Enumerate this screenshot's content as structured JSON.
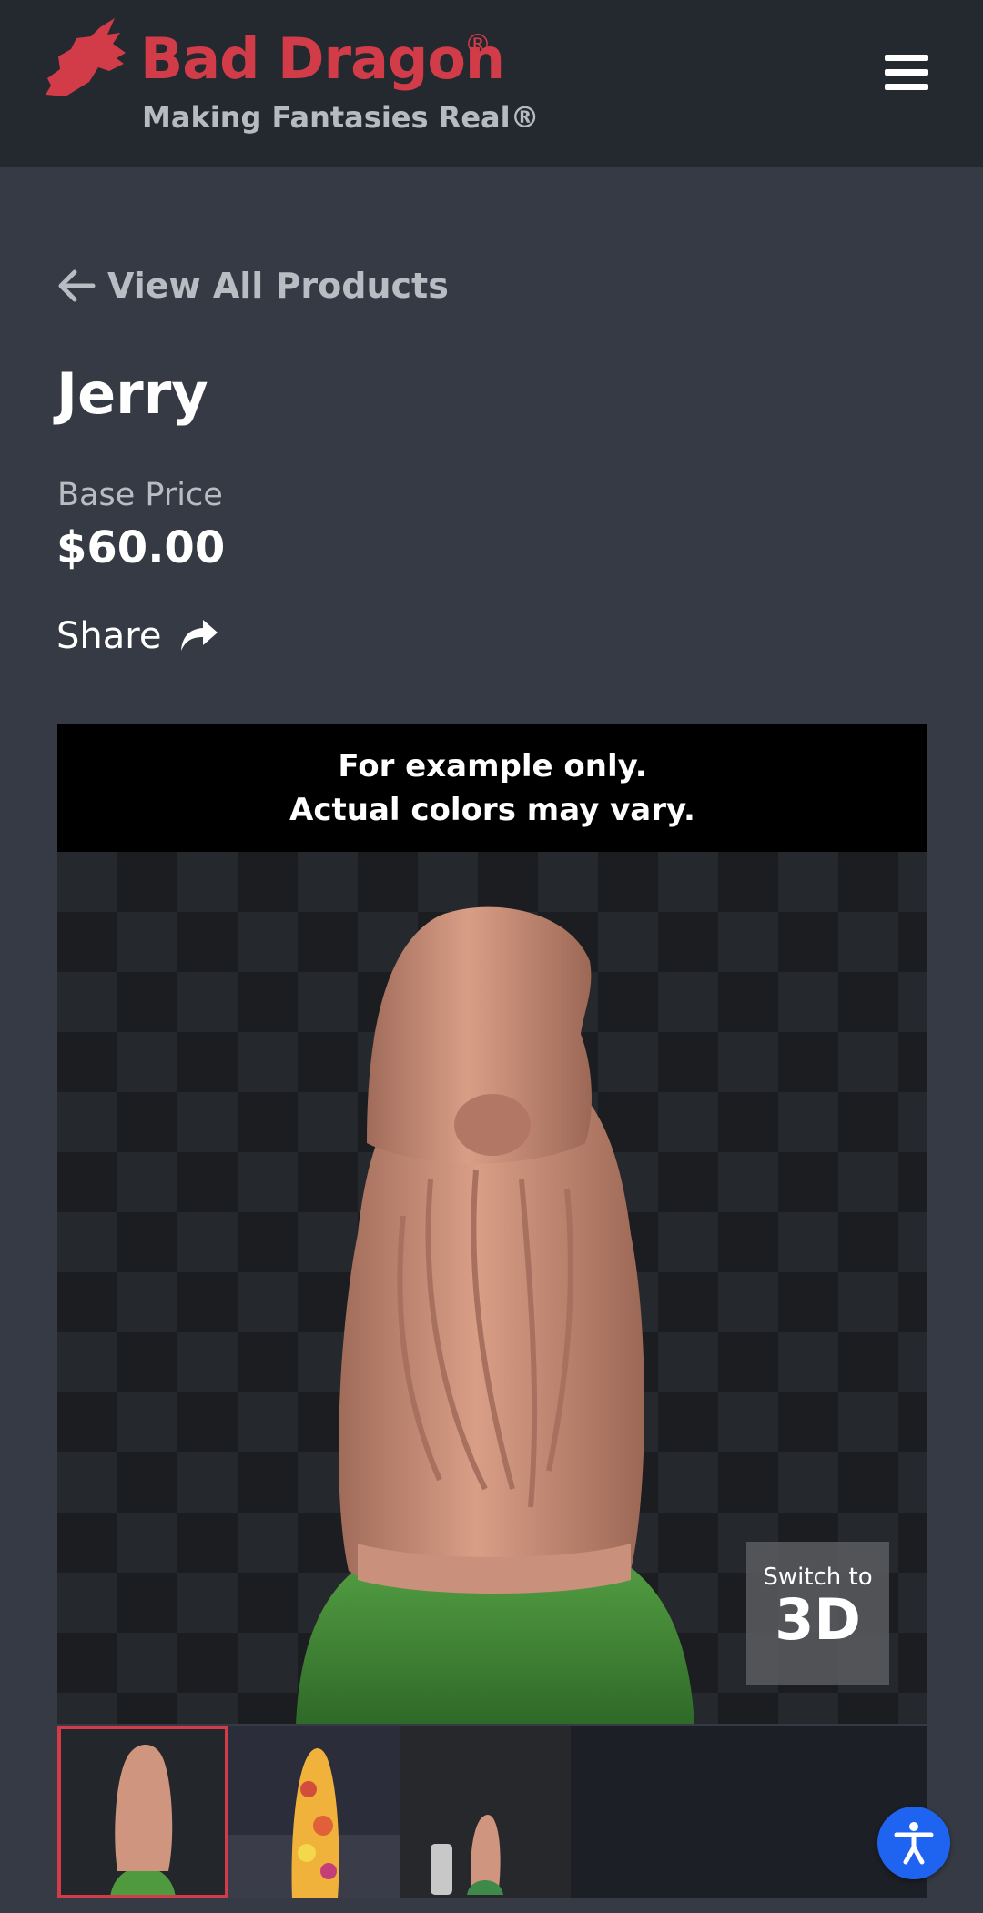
{
  "header": {
    "brand_name": "Bad Dragon",
    "brand_reg": "®",
    "tagline": "Making Fantasies Real®",
    "logo_icon": "dragon-head-logo",
    "menu_icon": "hamburger-menu-icon"
  },
  "nav": {
    "back_label": "View All Products",
    "back_icon": "arrow-left-icon"
  },
  "product": {
    "name": "Jerry",
    "price_label": "Base Price",
    "price": "$60.00",
    "share_label": "Share",
    "share_icon": "share-arrow-icon"
  },
  "viewer": {
    "disclaimer_line1": "For example only.",
    "disclaimer_line2": "Actual colors may vary.",
    "switch_label_top": "Switch to",
    "switch_label_bottom": "3D"
  },
  "thumbnails": [
    {
      "name": "thumb-flesh-render",
      "selected": true
    },
    {
      "name": "thumb-multicolor-photo",
      "selected": false
    },
    {
      "name": "thumb-size-comparison-photo",
      "selected": false
    }
  ],
  "accessibility": {
    "icon": "accessibility-person-icon"
  },
  "colors": {
    "brand_red": "#d13c48",
    "header_bg": "#24282f",
    "page_bg": "#353a44",
    "accessibility_blue": "#1f64f0"
  }
}
